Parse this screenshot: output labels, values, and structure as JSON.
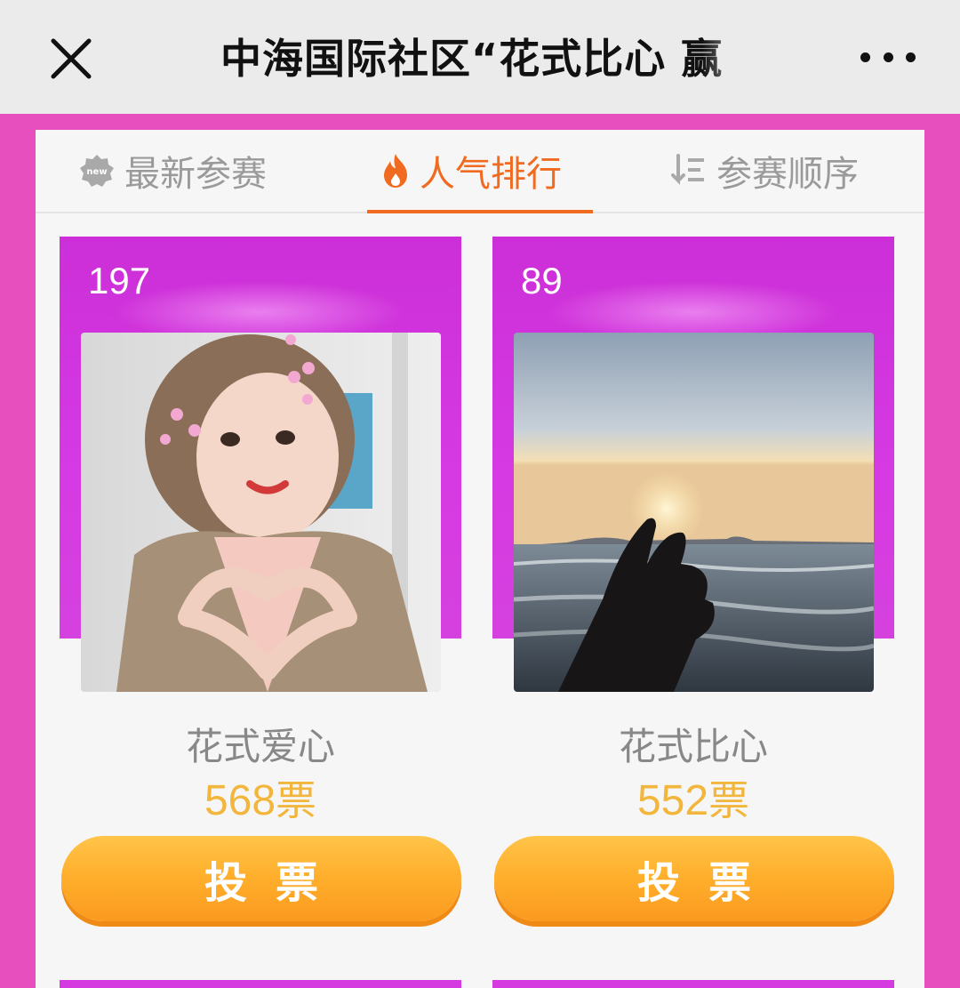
{
  "header": {
    "title": "中海国际社区“花式比心 赢",
    "close_icon": "close-icon",
    "more_icon": "more-dots-icon"
  },
  "tabs": [
    {
      "label": "最新参赛",
      "icon": "new-badge-icon",
      "active": false
    },
    {
      "label": "人气排行",
      "icon": "fire-icon",
      "active": true
    },
    {
      "label": "参赛顺序",
      "icon": "sort-order-icon",
      "active": false
    }
  ],
  "entries": [
    {
      "rank": "197",
      "name": "花式爱心",
      "votes": "568",
      "votes_unit": "票",
      "vote_button": "投票",
      "photo": "heart-hands-selfie"
    },
    {
      "rank": "89",
      "name": "花式比心",
      "votes": "552",
      "votes_unit": "票",
      "vote_button": "投票",
      "photo": "finger-heart-sunset-beach"
    }
  ],
  "colors": {
    "page_bg": "#e64fbd",
    "card_header": "#d63ae2",
    "active_tab": "#f06a1f",
    "votes_text": "#f2b63c",
    "vote_button": "#ffb02d"
  }
}
